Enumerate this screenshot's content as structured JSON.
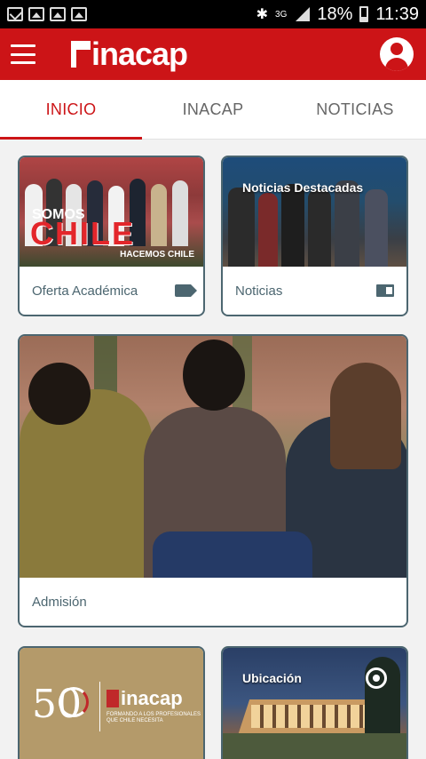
{
  "status_bar": {
    "left_icons": [
      "mail-icon",
      "image-icon",
      "photo-icon",
      "photo-icon"
    ],
    "network": "3G",
    "battery_percent": "18%",
    "time": "11:39"
  },
  "app_bar": {
    "brand": "inacap",
    "brand_color": "#cc1417"
  },
  "tabs": [
    {
      "label": "INICIO",
      "active": true
    },
    {
      "label": "INACAP",
      "active": false
    },
    {
      "label": "NOTICIAS",
      "active": false
    }
  ],
  "cards": {
    "oferta": {
      "label": "Oferta Académica",
      "icon": "tag-icon",
      "image_text": {
        "somos": "SOMOS",
        "chile": "CHILE",
        "hacemos": "HACEMOS CHILE"
      }
    },
    "noticias": {
      "label": "Noticias",
      "icon": "news-icon",
      "image_title": "Noticias Destacadas"
    },
    "admision": {
      "label": "Admisión"
    },
    "aniversario": {
      "fifty": "50",
      "brand": "inacap",
      "subtitle": "FORMANDO A LOS PROFESIONALES QUE CHILE NECESITA"
    },
    "ubicacion": {
      "image_title": "Ubicación",
      "icon": "location-target-icon"
    }
  },
  "colors": {
    "accent": "#cc1417",
    "card_border": "#4c6670",
    "tab_text": "#666666"
  }
}
